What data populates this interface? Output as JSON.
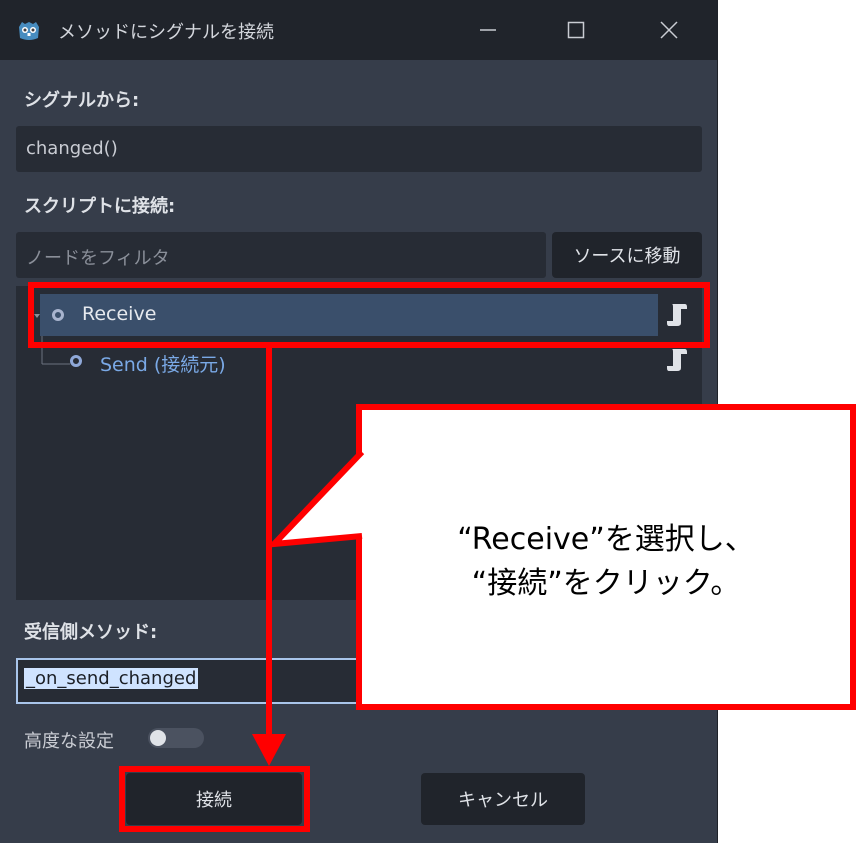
{
  "window": {
    "title": "メソッドにシグナルを接続"
  },
  "signal_section": {
    "label": "シグナルから:",
    "value": "changed()"
  },
  "script_section": {
    "label": "スクリプトに接続:",
    "filter_placeholder": "ノードをフィルタ",
    "goto_source_label": "ソースに移動"
  },
  "tree": {
    "items": [
      {
        "label": "Receive",
        "selected": true
      },
      {
        "label": "Send (接続元)",
        "selected": false
      }
    ]
  },
  "receiver_section": {
    "label": "受信側メソッド:",
    "value": "_on_send_changed"
  },
  "advanced": {
    "label": "高度な設定",
    "enabled": false
  },
  "buttons": {
    "connect_label": "接続",
    "cancel_label": "キャンセル"
  },
  "annotation": {
    "line1": "“Receive”を選択し、",
    "line2": "“接続”をクリック。",
    "color": "#ff0000"
  },
  "icons": {
    "app": "godot-icon",
    "minimize": "minimize-icon",
    "maximize": "maximize-icon",
    "close": "close-icon",
    "node": "node-circle-icon",
    "script": "script-icon"
  }
}
